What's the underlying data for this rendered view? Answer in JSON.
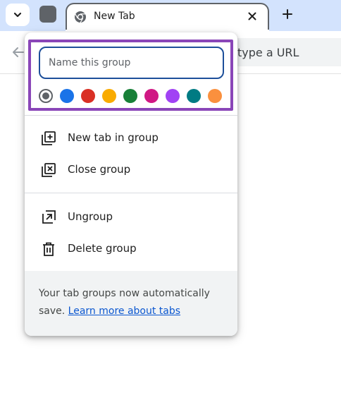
{
  "tab": {
    "title": "New Tab"
  },
  "omnibox": {
    "text": "type a URL"
  },
  "group_editor": {
    "name_placeholder": "Name this group",
    "colors": [
      "#5f6368",
      "#1a73e8",
      "#d93025",
      "#f9ab00",
      "#188038",
      "#d01884",
      "#a142f4",
      "#007b83",
      "#fa903e"
    ],
    "selected_color_index": 0,
    "menu": {
      "new_tab_in_group": "New tab in group",
      "close_group": "Close group",
      "ungroup": "Ungroup",
      "delete_group": "Delete group"
    },
    "footer": {
      "text": "Your tab groups now automatically save. ",
      "link": "Learn more about tabs"
    }
  },
  "accent": {
    "highlight": "#8a46b8",
    "link": "#0b57d0",
    "input_border": "#1d4f9a"
  }
}
